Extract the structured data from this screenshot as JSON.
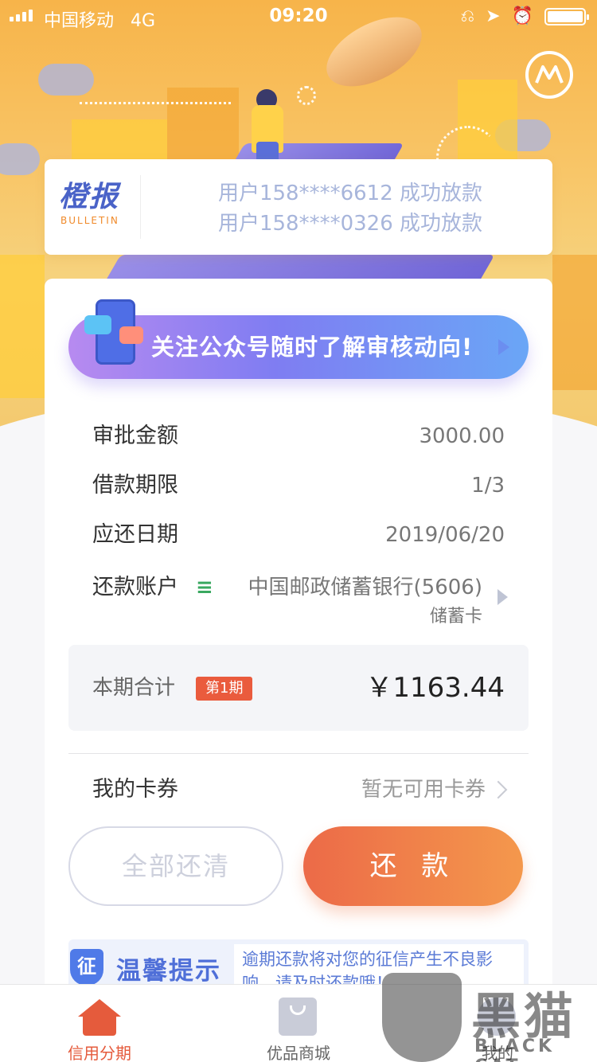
{
  "status_bar": {
    "carrier": "中国移动",
    "network": "4G",
    "time": "09:20"
  },
  "bulletin": {
    "logo_title": "橙报",
    "logo_sub": "BULLETIN",
    "lines": [
      "用户158****6612 成功放款",
      "用户158****0326 成功放款"
    ]
  },
  "follow_banner": {
    "text": "关注公众号随时了解审核动向!"
  },
  "loan": {
    "approval_amount_label": "审批金额",
    "approval_amount_value": "3000.00",
    "term_label": "借款期限",
    "term_value": "1/3",
    "due_date_label": "应还日期",
    "due_date_value": "2019/06/20",
    "account_label": "还款账户",
    "bank_name": "中国邮政储蓄银行(5606)",
    "card_type": "储蓄卡"
  },
  "total": {
    "label": "本期合计",
    "badge": "第1期",
    "amount": "￥1163.44"
  },
  "coupon": {
    "label": "我的卡券",
    "value": "暂无可用卡券"
  },
  "buttons": {
    "pay_all": "全部还清",
    "repay": "还 款"
  },
  "tip": {
    "badge": "征",
    "title": "温馨提示",
    "text": "逾期还款将对您的征信产生不良影响，请及时还款哦！"
  },
  "tabs": [
    {
      "label": "信用分期",
      "icon": "home-icon",
      "active": true
    },
    {
      "label": "优品商城",
      "icon": "bag-icon",
      "active": false
    },
    {
      "label": "我的",
      "icon": "user-icon",
      "active": false
    }
  ],
  "watermark": {
    "text": "黑猫",
    "sub": "BLACK CAT"
  },
  "colors": {
    "accent": "#e55b3c",
    "primary_gradient_start": "#ec6a48",
    "primary_gradient_end": "#f4984c",
    "banner_purple": "#7f7df2"
  }
}
